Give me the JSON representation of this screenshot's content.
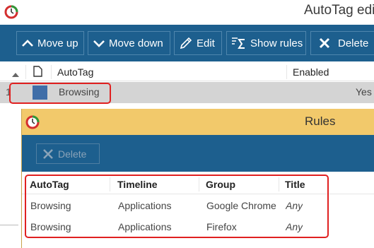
{
  "main_window": {
    "title": "AutoTag edi",
    "toolbar": {
      "move_up": "Move up",
      "move_down": "Move down",
      "edit": "Edit",
      "show_rules": "Show rules",
      "delete": "Delete"
    },
    "columns": {
      "autotag": "AutoTag",
      "enabled": "Enabled"
    },
    "rows": [
      {
        "number": "1",
        "name": "Browsing",
        "enabled": "Yes",
        "color": "#3f6ea8"
      }
    ]
  },
  "rules_window": {
    "title": "Rules",
    "delete_label": "Delete",
    "columns": [
      "AutoTag",
      "Timeline",
      "Group",
      "Title"
    ],
    "rows": [
      {
        "autotag": "Browsing",
        "timeline": "Applications",
        "group": "Google Chrome",
        "title": "Any"
      },
      {
        "autotag": "Browsing",
        "timeline": "Applications",
        "group": "Firefox",
        "title": "Any"
      }
    ]
  },
  "colors": {
    "toolbar_blue": "#1d5f8e",
    "rules_title_bar": "#f2c96b",
    "highlight_red": "#e02020",
    "selected_row": "#d4d4d4"
  },
  "icons": {
    "app_logo": "timer-logo-icon",
    "move_up": "chevron-up-icon",
    "move_down": "chevron-down-icon",
    "edit": "pencil-icon",
    "show_rules": "sigma-list-icon",
    "delete": "close-x-icon"
  }
}
